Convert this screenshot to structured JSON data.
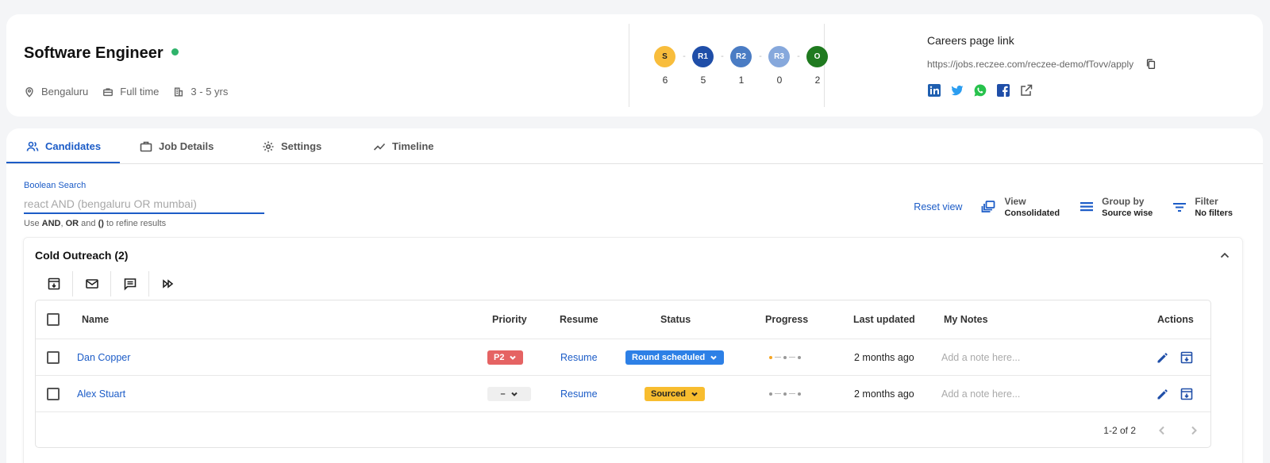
{
  "job": {
    "title": "Software Engineer",
    "location": "Bengaluru",
    "employment_type": "Full time",
    "experience": "3 - 5 yrs"
  },
  "stages": [
    {
      "label": "S",
      "count": "6",
      "color": "#f8bd3c"
    },
    {
      "label": "R1",
      "count": "5",
      "color": "#1f4ea8"
    },
    {
      "label": "R2",
      "count": "1",
      "color": "#4a7cc4"
    },
    {
      "label": "R3",
      "count": "0",
      "color": "#86a8dc"
    },
    {
      "label": "O",
      "count": "2",
      "color": "#1f7a1f"
    }
  ],
  "careers": {
    "label": "Careers page link",
    "url": "https://jobs.reczee.com/reczee-demo/fTovv/apply"
  },
  "tabs": {
    "candidates": "Candidates",
    "job_details": "Job Details",
    "settings": "Settings",
    "timeline": "Timeline"
  },
  "search": {
    "label": "Boolean Search",
    "placeholder": "react AND (bengaluru OR mumbai)",
    "help_prefix": "Use ",
    "help_and": "AND",
    "help_sep1": ", ",
    "help_or": "OR",
    "help_sep2": " and ",
    "help_paren": "()",
    "help_suffix": " to refine results"
  },
  "controls": {
    "reset": "Reset view",
    "view_title": "View",
    "view_value": "Consolidated",
    "group_title": "Group by",
    "group_value": "Source wise",
    "filter_title": "Filter",
    "filter_value": "No filters"
  },
  "group": {
    "title": "Cold Outreach (2)"
  },
  "table": {
    "headers": {
      "name": "Name",
      "priority": "Priority",
      "resume": "Resume",
      "status": "Status",
      "progress": "Progress",
      "last_updated": "Last updated",
      "notes": "My Notes",
      "actions": "Actions"
    },
    "rows": [
      {
        "name": "Dan Copper",
        "priority": "P2",
        "resume": "Resume",
        "status": "Round scheduled",
        "last_updated": "2 months ago",
        "note_placeholder": "Add a note here..."
      },
      {
        "name": "Alex Stuart",
        "priority": "–",
        "resume": "Resume",
        "status": "Sourced",
        "last_updated": "2 months ago",
        "note_placeholder": "Add a note here..."
      }
    ],
    "pagination": "1-2 of 2"
  },
  "colors": {
    "accent": "#1c5cc7",
    "status_active": "#2fb36b"
  }
}
